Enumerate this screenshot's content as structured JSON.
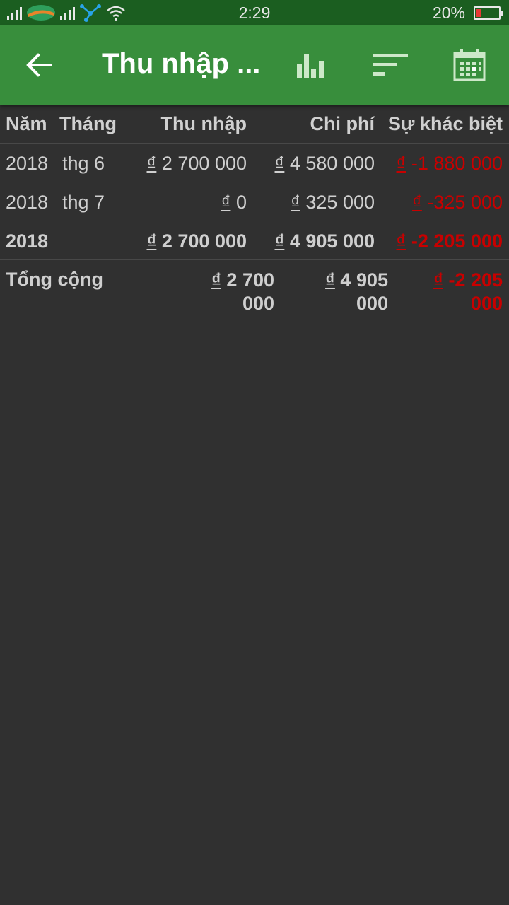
{
  "status_bar": {
    "time": "2:29",
    "battery": "20%",
    "battery_level": 0.2,
    "icons": [
      "signal-icon",
      "carrier-logo-icon",
      "signal-icon",
      "network-share-icon",
      "wifi-icon",
      "battery-icon"
    ]
  },
  "app_bar": {
    "title": "Thu nhập ...",
    "icons": [
      "back-arrow-icon",
      "bar-chart-icon",
      "sort-icon",
      "calendar-icon"
    ]
  },
  "table": {
    "headers": {
      "year": "Năm",
      "month": "Tháng",
      "income": "Thu nhập",
      "expense": "Chi phí",
      "difference": "Sự khác biệt"
    },
    "currency_symbol": "₫",
    "rows": [
      {
        "year": "2018",
        "month": "thg 6",
        "income": "2 700 000",
        "expense": "4 580 000",
        "difference": "-1 880 000"
      },
      {
        "year": "2018",
        "month": "thg 7",
        "income": "0",
        "expense": "325 000",
        "difference": "-325 000"
      }
    ],
    "subtotal": {
      "year": "2018",
      "income": "2 700 000",
      "expense": "4 905 000",
      "difference": "-2 205 000"
    },
    "total": {
      "label": "Tổng cộng",
      "income": "2 700 000",
      "expense": "4 905 000",
      "difference": "-2 205 000"
    }
  },
  "colors": {
    "status_bar": "#1b5e20",
    "app_bar": "#388e3c",
    "background": "#303030",
    "negative": "#c80000"
  }
}
